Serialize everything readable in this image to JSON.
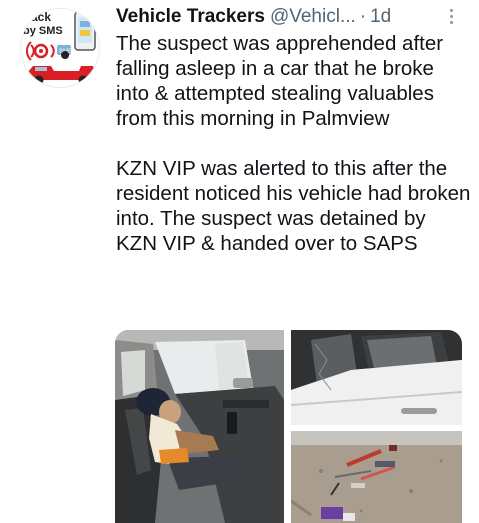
{
  "tweet": {
    "display_name": "Vehicle Trackers",
    "handle": "@Vehicl...",
    "separator": "·",
    "time": "1d",
    "paragraphs": [
      "The suspect was apprehended after falling asleep in a car that he broke into & attempted stealing valuables from this morning in Palmview",
      "KZN VIP was alerted to this after the resident noticed his vehicle had broken into. The suspect was detained by KZN VIP & handed over to SAPS"
    ]
  },
  "avatar": {
    "logo_text_line1": "ack",
    "logo_text_line2": "by SMS"
  },
  "icons": {
    "more": "more-vertical-icon"
  },
  "colors": {
    "text": "#0f1419",
    "secondary": "#536471",
    "truck_red": "#d81f26"
  }
}
